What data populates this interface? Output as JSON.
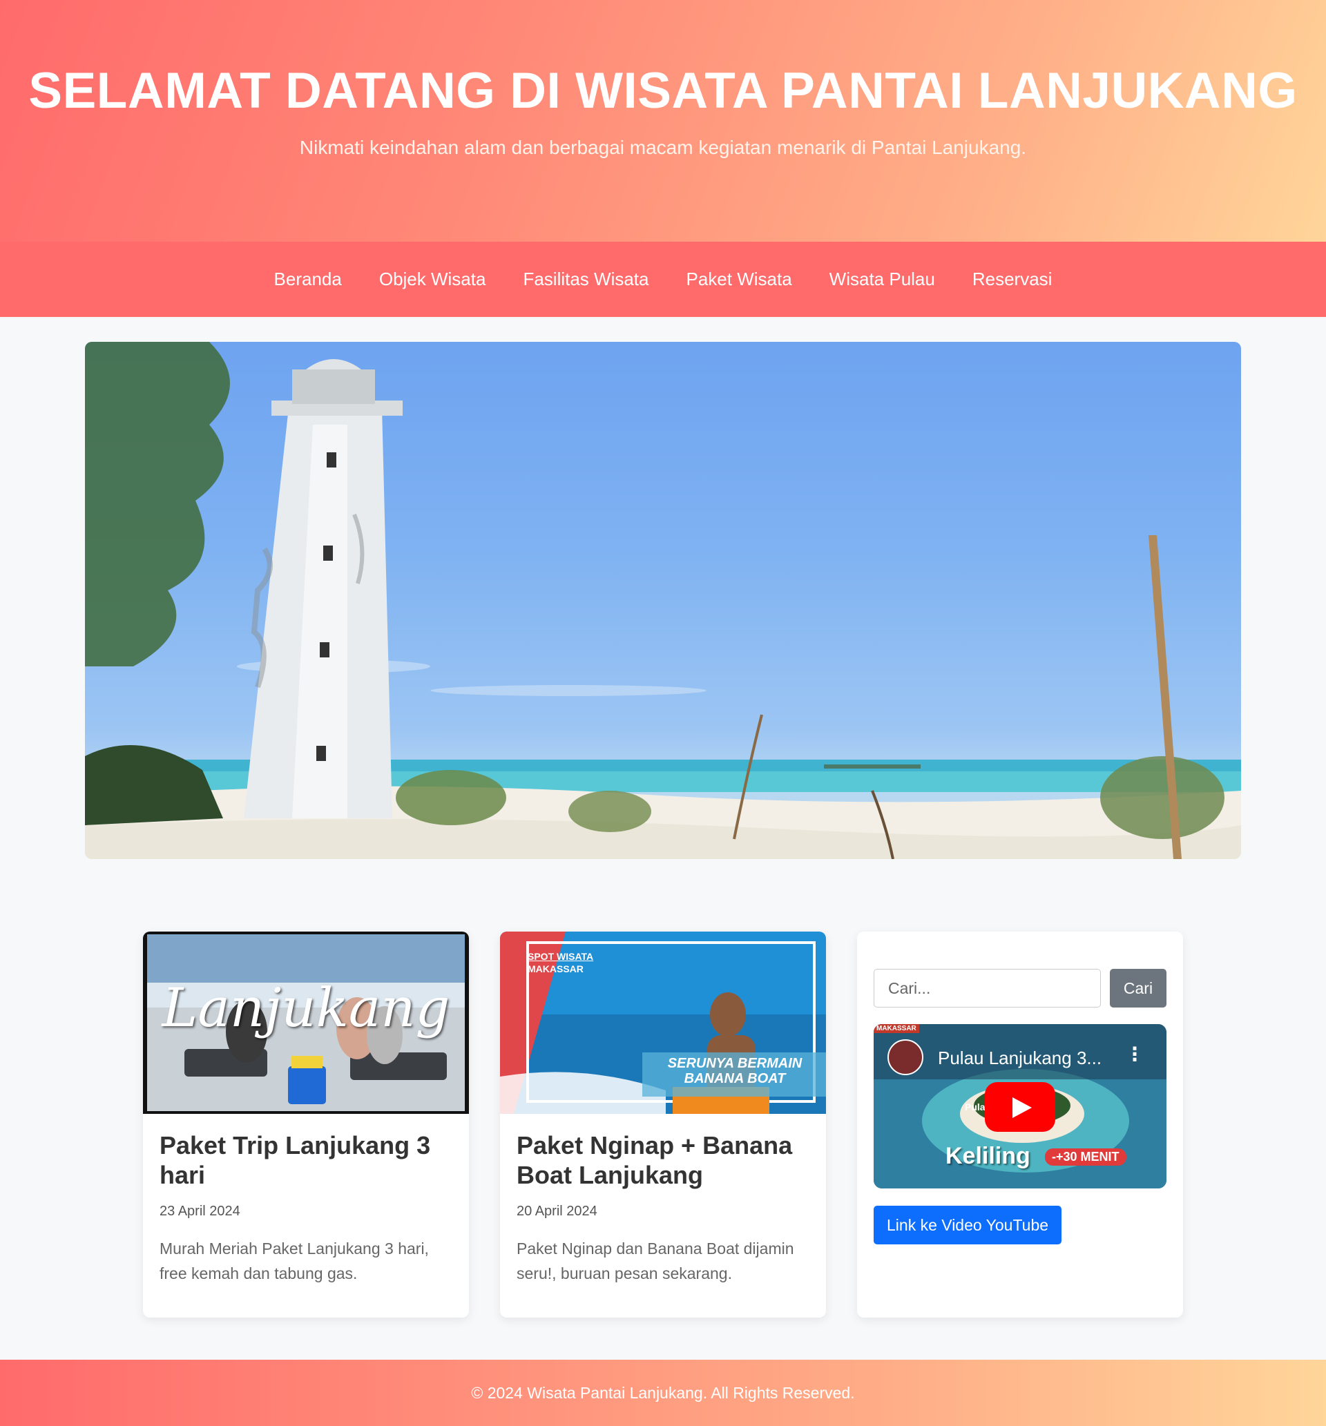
{
  "header": {
    "title": "SELAMAT DATANG DI WISATA PANTAI LANJUKANG",
    "subtitle": "Nikmati keindahan alam dan berbagai macam kegiatan menarik di Pantai Lanjukang."
  },
  "nav": {
    "items": [
      "Beranda",
      "Objek Wisata",
      "Fasilitas Wisata",
      "Paket Wisata",
      "Wisata Pulau",
      "Reservasi"
    ]
  },
  "banner": {
    "icon": "lighthouse-beach-photo"
  },
  "cards": [
    {
      "thumb_text": "Lanjukang",
      "title": "Paket Trip Lanjukang 3 hari",
      "date": "23 April 2024",
      "description": "Murah Meriah Paket Lanjukang 3 hari, free kemah dan tabung gas."
    },
    {
      "thumb_badge_line1": "SPOT WISATA",
      "thumb_badge_line2": "MAKASSAR",
      "thumb_caption_line1": "SERUNYA BERMAIN",
      "thumb_caption_line2": "BANANA BOAT",
      "title": "Paket Nginap + Banana Boat Lanjukang",
      "date": "20 April 2024",
      "description": "Paket Nginap dan Banana Boat dijamin seru!, buruan pesan sekarang."
    }
  ],
  "sidebar": {
    "search_placeholder": "Cari...",
    "search_button": "Cari",
    "video": {
      "channel_tag": "MAKASSAR",
      "title": "Pulau Lanjukang 3...",
      "overlay_word": "Keliling",
      "overlay_badge": "-+30 MENIT",
      "overlay_small": "Pula"
    },
    "link_label": "Link ke Video YouTube"
  },
  "footer": {
    "text": "© 2024 Wisata Pantai Lanjukang. All Rights Reserved."
  },
  "colors": {
    "primary": "#ff6b6b",
    "accent_light": "#ffd59a",
    "search_button": "#6c757d",
    "link_button": "#0d6efd"
  }
}
